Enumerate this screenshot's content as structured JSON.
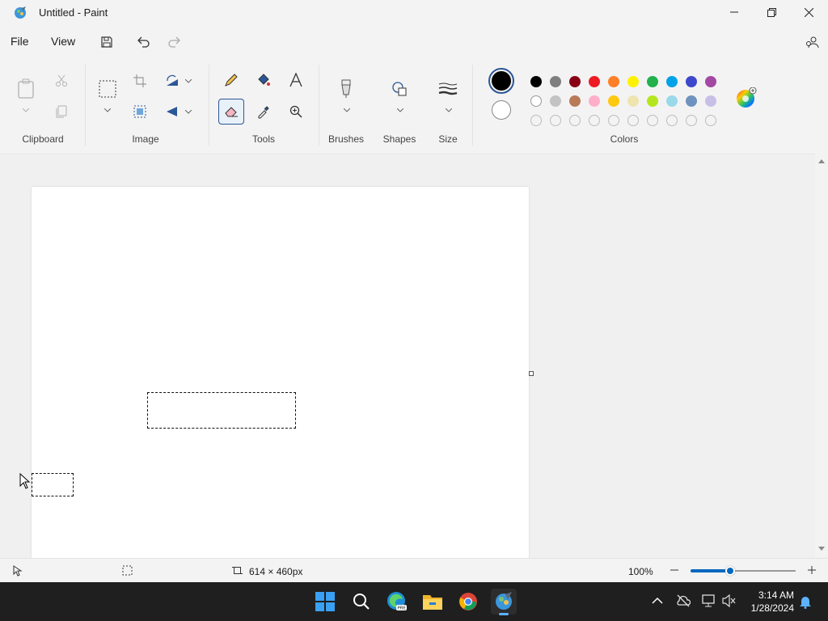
{
  "window": {
    "title": "Untitled - Paint"
  },
  "menu": {
    "file": "File",
    "view": "View"
  },
  "ribbon": {
    "groups": {
      "clipboard": "Clipboard",
      "image": "Image",
      "tools": "Tools",
      "brushes": "Brushes",
      "shapes": "Shapes",
      "size": "Size",
      "colors": "Colors"
    },
    "primary_color": "#000000",
    "secondary_color": "#ffffff",
    "palette_row1": [
      "#000000",
      "#7f7f7f",
      "#880015",
      "#ed1c24",
      "#ff7f27",
      "#fff200",
      "#22b14c",
      "#00a2e8",
      "#3f48cc",
      "#a349a4"
    ],
    "palette_row2": [
      "#ffffff",
      "#c3c3c3",
      "#b97a57",
      "#ffaec9",
      "#ffc90e",
      "#efe4b0",
      "#b5e61d",
      "#99d9ea",
      "#7092be",
      "#c8bfe7"
    ]
  },
  "status": {
    "canvas_size": "614 × 460px",
    "zoom": "100%",
    "zoom_value": 100
  },
  "taskbar": {
    "time": "3:14 AM",
    "date": "1/28/2024"
  }
}
